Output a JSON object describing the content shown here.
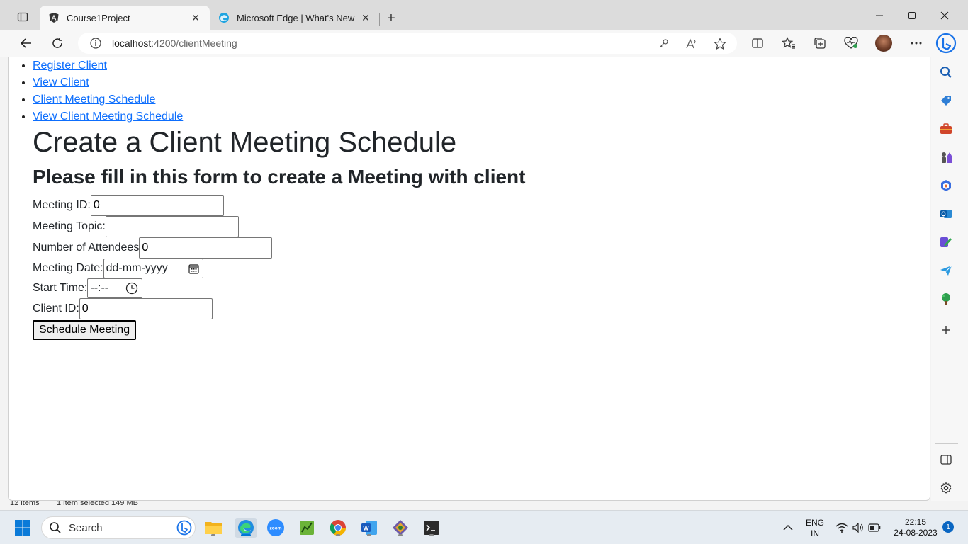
{
  "browser": {
    "tabs": [
      {
        "title": "Course1Project",
        "active": true
      },
      {
        "title": "Microsoft Edge | What's New",
        "active": false
      }
    ],
    "address": {
      "host": "localhost",
      "path": ":4200/clientMeeting"
    }
  },
  "nav": {
    "links": [
      {
        "label": "Register Client"
      },
      {
        "label": "View Client"
      },
      {
        "label": "Client Meeting Schedule"
      },
      {
        "label": "View Client Meeting Schedule"
      }
    ]
  },
  "page": {
    "title": "Create a Client Meeting Schedule",
    "subtitle": "Please fill in this form to create a Meeting with client"
  },
  "form": {
    "meeting_id": {
      "label": "Meeting ID:",
      "value": "0"
    },
    "meeting_topic": {
      "label": "Meeting Topic:",
      "value": ""
    },
    "attendees": {
      "label": "Number of Attendees",
      "value": "0"
    },
    "meeting_date": {
      "label": "Meeting Date:",
      "value": "dd-mm-yyyy"
    },
    "start_time": {
      "label": "Start Time:",
      "value": "--:--"
    },
    "client_id": {
      "label": "Client ID:",
      "value": "0"
    },
    "submit_label": "Schedule Meeting"
  },
  "statusstrip": {
    "items": "12 items",
    "selected": "1 item selected  149 MB"
  },
  "taskbar": {
    "search_placeholder": "Search",
    "lang_line1": "ENG",
    "lang_line2": "IN",
    "time": "22:15",
    "date": "24-08-2023",
    "notification_count": "1"
  },
  "colors": {
    "link": "#0d6efd",
    "edge_accent": "#0078d4",
    "bing_blue": "#1a73e8"
  }
}
